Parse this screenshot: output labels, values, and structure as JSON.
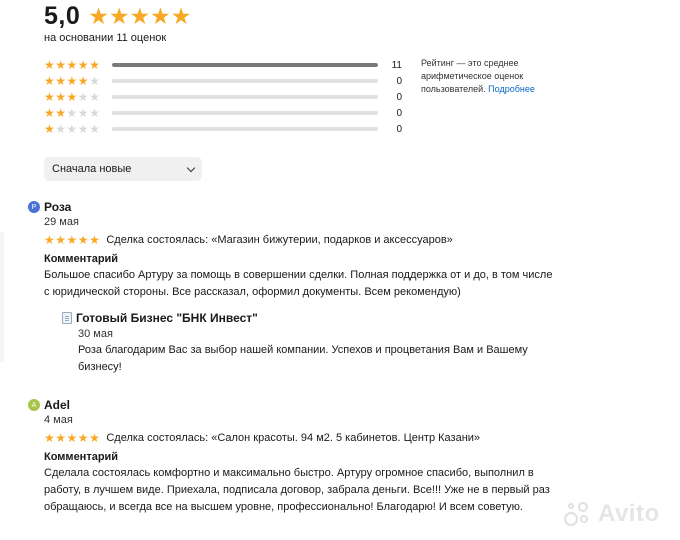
{
  "summary": {
    "score": "5,0",
    "based_on": "на основании 11 оценок",
    "stars_filled": 5
  },
  "breakdown": [
    {
      "stars": 5,
      "count": "11",
      "fraction": 1.0
    },
    {
      "stars": 4,
      "count": "0",
      "fraction": 0
    },
    {
      "stars": 3,
      "count": "0",
      "fraction": 0
    },
    {
      "stars": 2,
      "count": "0",
      "fraction": 0
    },
    {
      "stars": 1,
      "count": "0",
      "fraction": 0
    }
  ],
  "rating_note": {
    "text": "Рейтинг — это среднее арифметическое оценок пользователей.",
    "link": "Подробнее"
  },
  "sort": {
    "selected": "Сначала новые"
  },
  "reviews": [
    {
      "avatar_letter": "Р",
      "avatar_color": "#4a72d6",
      "author": "Роза",
      "date": "29 мая",
      "rating": 5,
      "deal": "Сделка состоялась: «Магазин бижутерии, подарков и аксессуаров»",
      "comment_title": "Комментарий",
      "comment": "Большое спасибо Артуру за помощь в совершении сделки. Полная поддержка от и до, в том числе с юридической стороны. Все рассказал, оформил документы. Всем рекомендую)",
      "reply": {
        "name": "Готовый Бизнес \"БНК Инвест\"",
        "date": "30 мая",
        "text": "Роза благодарим Вас за выбор нашей компании. Успехов и процветания Вам и Вашему бизнесу!"
      }
    },
    {
      "avatar_letter": "A",
      "avatar_color": "#a7c44a",
      "author": "Adel",
      "date": "4 мая",
      "rating": 5,
      "deal": "Сделка состоялась: «Салон красоты. 94 м2. 5 кабинетов. Центр Казани»",
      "comment_title": "Комментарий",
      "comment": "Сделала состоялась комфортно и максимально быстро. Артуру огромное спасибо, выполнил в работу, в лучшем виде. Приехала, подписала договор, забрала деньги. Все!!! Уже не в первый раз обращаюсь, и всегда все на высшем уровне, профессионально! Благодарю! И всем советую."
    }
  ],
  "watermark": "Avito",
  "colors": {
    "star_on": "#f9a825",
    "star_off": "#d9d9d9",
    "link": "#0a69c4"
  }
}
